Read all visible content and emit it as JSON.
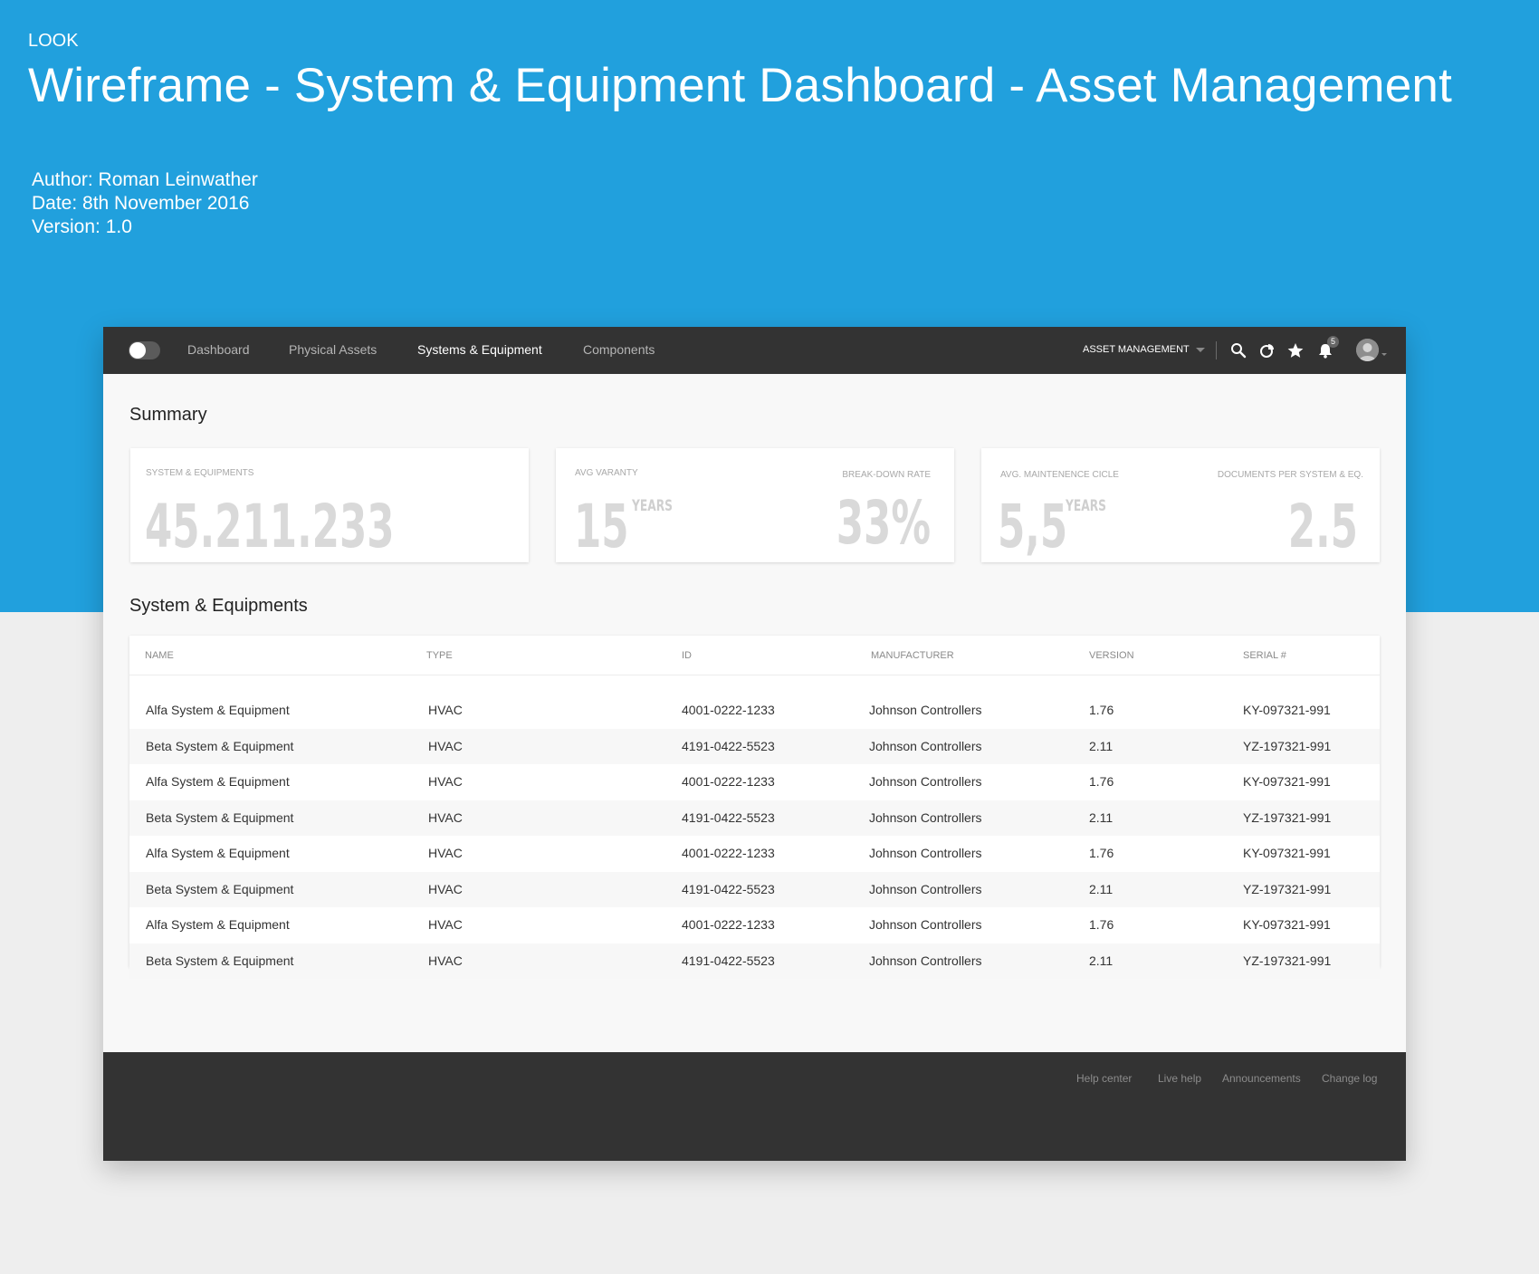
{
  "doc": {
    "label": "LOOK",
    "title": "Wireframe - System & Equipment Dashboard - Asset Management",
    "author": "Author: Roman Leinwather",
    "date": "Date: 8th November 2016",
    "version": "Version: 1.0"
  },
  "colors": {
    "banner": "#21a0dd",
    "topbar": "#333333",
    "footer": "#333333",
    "page_background": "#eeeeee",
    "big_number": "#d9d9d9"
  },
  "topbar": {
    "nav": [
      {
        "label": "Dashboard",
        "active": false
      },
      {
        "label": "Physical Assets",
        "active": false
      },
      {
        "label": "Systems & Equipment",
        "active": true
      },
      {
        "label": "Components",
        "active": false
      }
    ],
    "module": "ASSET MANAGEMENT",
    "icons": [
      "search-icon",
      "pie-chart-icon",
      "star-icon",
      "bell-icon"
    ],
    "notification_count": "5"
  },
  "summary": {
    "title": "Summary",
    "cards": [
      {
        "left_label": "SYSTEM & EQUIPMENTS",
        "left_value": "45.211.233"
      },
      {
        "left_label": "AVG VARANTY",
        "left_value": "15",
        "left_unit": "YEARS",
        "right_label": "BREAK-DOWN RATE",
        "right_value": "33%"
      },
      {
        "left_label": "AVG. MAINTENENCE CICLE",
        "left_value": "5,5",
        "left_unit": "YEARS",
        "right_label": "DOCUMENTS PER SYSTEM & EQ.",
        "right_value": "2.5"
      }
    ]
  },
  "table": {
    "title": "System & Equipments",
    "columns": [
      "NAME",
      "TYPE",
      "ID",
      "MANUFACTURER",
      "VERSION",
      "SERIAL #"
    ],
    "rows": [
      [
        "Alfa System & Equipment",
        "HVAC",
        "4001-0222-1233",
        "Johnson Controllers",
        "1.76",
        "KY-097321-991"
      ],
      [
        "Beta System & Equipment",
        "HVAC",
        "4191-0422-5523",
        "Johnson Controllers",
        "2.11",
        "YZ-197321-991"
      ],
      [
        "Alfa System & Equipment",
        "HVAC",
        "4001-0222-1233",
        "Johnson Controllers",
        "1.76",
        "KY-097321-991"
      ],
      [
        "Beta System & Equipment",
        "HVAC",
        "4191-0422-5523",
        "Johnson Controllers",
        "2.11",
        "YZ-197321-991"
      ],
      [
        "Alfa System & Equipment",
        "HVAC",
        "4001-0222-1233",
        "Johnson Controllers",
        "1.76",
        "KY-097321-991"
      ],
      [
        "Beta System & Equipment",
        "HVAC",
        "4191-0422-5523",
        "Johnson Controllers",
        "2.11",
        "YZ-197321-991"
      ],
      [
        "Alfa System & Equipment",
        "HVAC",
        "4001-0222-1233",
        "Johnson Controllers",
        "1.76",
        "KY-097321-991"
      ],
      [
        "Beta System & Equipment",
        "HVAC",
        "4191-0422-5523",
        "Johnson Controllers",
        "2.11",
        "YZ-197321-991"
      ]
    ]
  },
  "footer": {
    "links": [
      "Help center",
      "Live help",
      "Announcements",
      "Change log"
    ]
  }
}
